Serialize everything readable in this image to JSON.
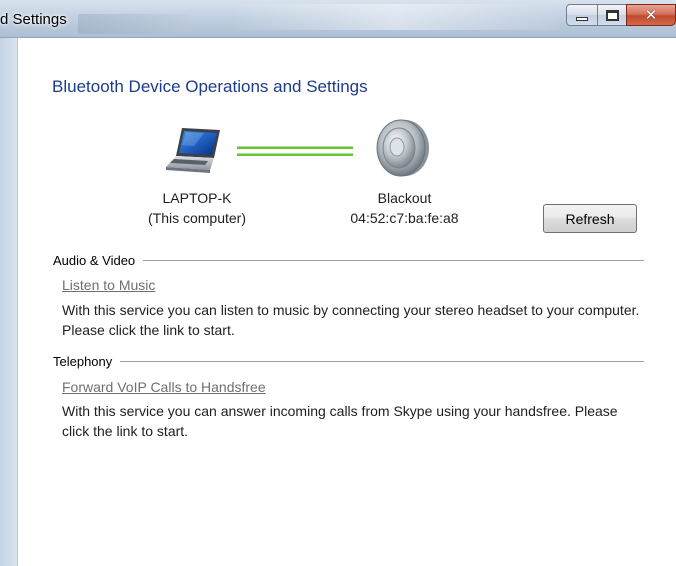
{
  "window": {
    "title": "d Settings",
    "buttons": {
      "minimize": "minimize-icon",
      "maximize": "maximize-icon",
      "close": "close-icon"
    }
  },
  "heading": "Bluetooth Device Operations and Settings",
  "computer": {
    "name": "LAPTOP-K",
    "note": "(This computer)",
    "icon": "laptop-icon"
  },
  "device": {
    "name": "Blackout",
    "address": "04:52:c7:ba:fe:a8",
    "icon": "speaker-icon"
  },
  "connection_color": "#6ac23a",
  "refresh_label": "Refresh",
  "sections": [
    {
      "title": "Audio & Video",
      "link": "Listen to Music",
      "description": "With this service you can listen to music by connecting your stereo headset to your computer. Please click the link to start."
    },
    {
      "title": "Telephony",
      "link": "Forward VoIP Calls to Handsfree",
      "description": "With this service you can answer incoming calls from Skype using your handsfree. Please click the link to start."
    }
  ],
  "colors": {
    "heading": "#1c3b8d",
    "link": "#6f6f6f"
  }
}
